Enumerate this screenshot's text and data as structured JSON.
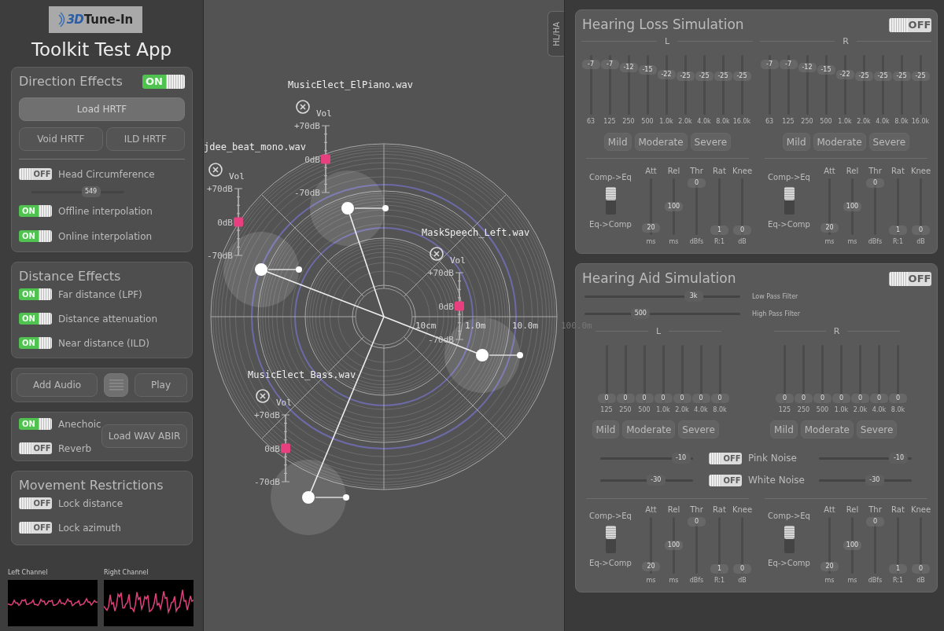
{
  "logo": {
    "mark": "3D",
    "text": "Tune-In"
  },
  "app_title": "Toolkit Test App",
  "direction_effects": {
    "title": "Direction Effects",
    "on": true,
    "switch_text": "ON",
    "load_button": "Load HRTF",
    "buttons": [
      "Void HRTF",
      "ILD HRTF"
    ],
    "head_circumference": {
      "label": "Head Circumference",
      "on": false,
      "switch_text": "OFF",
      "slider": {
        "value": "549",
        "level": 0.64
      }
    },
    "toggles": [
      {
        "label": "Offline interpolation",
        "on": true,
        "switch_text": "ON"
      },
      {
        "label": "Online interpolation",
        "on": true,
        "switch_text": "ON"
      }
    ]
  },
  "distance_effects": {
    "title": "Distance Effects",
    "toggles": [
      {
        "label": "Far distance (LPF)",
        "on": true,
        "switch_text": "ON"
      },
      {
        "label": "Distance attenuation",
        "on": true,
        "switch_text": "ON"
      },
      {
        "label": "Near distance (ILD)",
        "on": true,
        "switch_text": "ON"
      }
    ]
  },
  "audio_controls": [
    {
      "kind": "text",
      "label": "Add Audio"
    },
    {
      "kind": "menu"
    },
    {
      "kind": "text",
      "label": "Play"
    }
  ],
  "environment": {
    "toggles": [
      {
        "label": "Anechoic",
        "on": true,
        "switch_text": "ON"
      },
      {
        "label": "Reverb",
        "on": false,
        "switch_text": "OFF"
      }
    ],
    "button": "Load WAV ABIR"
  },
  "movement_restrictions": {
    "title": "Movement Restrictions",
    "toggles": [
      {
        "label": "Lock distance",
        "on": false,
        "switch_text": "OFF"
      },
      {
        "label": "Lock azimuth",
        "on": false,
        "switch_text": "OFF"
      }
    ]
  },
  "meters": [
    {
      "label": "Left Channel"
    },
    {
      "label": "Right Channel"
    }
  ],
  "scene": {
    "tab": "HL/HA",
    "distance_labels": [
      "10cm",
      "1.0m",
      "10.0m",
      "100.0m"
    ],
    "sources": [
      {
        "name": "MusicElect_ElPiano.wav",
        "vol_label": "Vol",
        "scale_labels": [
          "+70dB",
          "0dB",
          "-70dB"
        ]
      },
      {
        "name": "jdee_beat_mono.wav",
        "vol_label": "Vol",
        "scale_labels": [
          "+70dB",
          "0dB",
          "-70dB"
        ]
      },
      {
        "name": "MaskSpeech_Left.wav",
        "vol_label": "Vol",
        "scale_labels": [
          "+70dB",
          "0dB",
          "-70dB"
        ]
      },
      {
        "name": "MusicElect_Bass.wav",
        "vol_label": "Vol",
        "scale_labels": [
          "+70dB",
          "0dB",
          "-70dB"
        ]
      }
    ]
  },
  "hearing_loss": {
    "title": "Hearing Loss Simulation",
    "on": false,
    "switch_text": "OFF",
    "channels": [
      {
        "label": "L",
        "bands": [
          {
            "value": "-7",
            "freq": "63",
            "level": 0.9
          },
          {
            "value": "-7",
            "freq": "125",
            "level": 0.9
          },
          {
            "value": "-12",
            "freq": "250",
            "level": 0.84
          },
          {
            "value": "-15",
            "freq": "500",
            "level": 0.8
          },
          {
            "value": "-22",
            "freq": "1.0k",
            "level": 0.71
          },
          {
            "value": "-25",
            "freq": "2.0k",
            "level": 0.67
          },
          {
            "value": "-25",
            "freq": "4.0k",
            "level": 0.67
          },
          {
            "value": "-25",
            "freq": "8.0k",
            "level": 0.67
          },
          {
            "value": "-25",
            "freq": "16.0k",
            "level": 0.67
          }
        ],
        "presets": [
          "Mild",
          "Moderate",
          "Severe"
        ],
        "compressor": {
          "upper_label": "Comp->Eq",
          "lower_label": "Eq->Comp",
          "comp_to_eq": true,
          "sliders": [
            {
              "name": "Att",
              "value": "20",
              "unit": "ms",
              "level": 0.05
            },
            {
              "name": "Rel",
              "value": "100",
              "unit": "ms",
              "level": 0.5
            },
            {
              "name": "Thr",
              "value": "0",
              "unit": "dBfs",
              "level": 1
            },
            {
              "name": "Rat",
              "value": "1",
              "unit": "R:1",
              "level": 0
            },
            {
              "name": "Knee",
              "value": "0",
              "unit": "dB",
              "level": 0
            }
          ]
        }
      },
      {
        "label": "R",
        "bands": [
          {
            "value": "-7",
            "freq": "63",
            "level": 0.9
          },
          {
            "value": "-7",
            "freq": "125",
            "level": 0.9
          },
          {
            "value": "-12",
            "freq": "250",
            "level": 0.84
          },
          {
            "value": "-15",
            "freq": "500",
            "level": 0.8
          },
          {
            "value": "-22",
            "freq": "1.0k",
            "level": 0.71
          },
          {
            "value": "-25",
            "freq": "2.0k",
            "level": 0.67
          },
          {
            "value": "-25",
            "freq": "4.0k",
            "level": 0.67
          },
          {
            "value": "-25",
            "freq": "8.0k",
            "level": 0.67
          },
          {
            "value": "-25",
            "freq": "16.0k",
            "level": 0.67
          }
        ],
        "presets": [
          "Mild",
          "Moderate",
          "Severe"
        ],
        "compressor": {
          "upper_label": "Comp->Eq",
          "lower_label": "Eq->Comp",
          "comp_to_eq": true,
          "sliders": [
            {
              "name": "Att",
              "value": "20",
              "unit": "ms",
              "level": 0.05
            },
            {
              "name": "Rel",
              "value": "100",
              "unit": "ms",
              "level": 0.5
            },
            {
              "name": "Thr",
              "value": "0",
              "unit": "dBfs",
              "level": 1
            },
            {
              "name": "Rat",
              "value": "1",
              "unit": "R:1",
              "level": 0
            },
            {
              "name": "Knee",
              "value": "0",
              "unit": "dB",
              "level": 0
            }
          ]
        }
      }
    ]
  },
  "hearing_aid": {
    "title": "Hearing Aid Simulation",
    "on": false,
    "switch_text": "OFF",
    "filters": [
      {
        "label": "Low Pass Filter",
        "value": "3k",
        "level": 0.7
      },
      {
        "label": "High Pass Filter",
        "value": "500",
        "level": 0.36
      }
    ],
    "channels": [
      {
        "label": "L",
        "bands": [
          {
            "value": "0",
            "freq": "125",
            "level": 0
          },
          {
            "value": "0",
            "freq": "250",
            "level": 0
          },
          {
            "value": "0",
            "freq": "500",
            "level": 0
          },
          {
            "value": "0",
            "freq": "1.0k",
            "level": 0
          },
          {
            "value": "0",
            "freq": "2.0k",
            "level": 0
          },
          {
            "value": "0",
            "freq": "4.0k",
            "level": 0
          },
          {
            "value": "0",
            "freq": "8.0k",
            "level": 0
          }
        ],
        "presets": [
          "Mild",
          "Moderate",
          "Severe"
        ],
        "compressor": {
          "upper_label": "Comp->Eq",
          "lower_label": "Eq->Comp",
          "comp_to_eq": true,
          "sliders": [
            {
              "name": "Att",
              "value": "20",
              "unit": "ms",
              "level": 0.05
            },
            {
              "name": "Rel",
              "value": "100",
              "unit": "ms",
              "level": 0.5
            },
            {
              "name": "Thr",
              "value": "0",
              "unit": "dBfs",
              "level": 1
            },
            {
              "name": "Rat",
              "value": "1",
              "unit": "R:1",
              "level": 0
            },
            {
              "name": "Knee",
              "value": "0",
              "unit": "dB",
              "level": 0
            }
          ]
        }
      },
      {
        "label": "R",
        "bands": [
          {
            "value": "0",
            "freq": "125",
            "level": 0
          },
          {
            "value": "0",
            "freq": "250",
            "level": 0
          },
          {
            "value": "0",
            "freq": "500",
            "level": 0
          },
          {
            "value": "0",
            "freq": "1.0k",
            "level": 0
          },
          {
            "value": "0",
            "freq": "2.0k",
            "level": 0
          },
          {
            "value": "0",
            "freq": "4.0k",
            "level": 0
          },
          {
            "value": "0",
            "freq": "8.0k",
            "level": 0
          }
        ],
        "presets": [
          "Mild",
          "Moderate",
          "Severe"
        ],
        "compressor": {
          "upper_label": "Comp->Eq",
          "lower_label": "Eq->Comp",
          "comp_to_eq": true,
          "sliders": [
            {
              "name": "Att",
              "value": "20",
              "unit": "ms",
              "level": 0.05
            },
            {
              "name": "Rel",
              "value": "100",
              "unit": "ms",
              "level": 0.5
            },
            {
              "name": "Thr",
              "value": "0",
              "unit": "dBfs",
              "level": 1
            },
            {
              "name": "Rat",
              "value": "1",
              "unit": "R:1",
              "level": 0
            },
            {
              "name": "Knee",
              "value": "0",
              "unit": "dB",
              "level": 0
            }
          ]
        }
      }
    ],
    "noise": [
      {
        "label": "Pink Noise",
        "on": false,
        "switch_text": "OFF",
        "left": {
          "value": "-10",
          "level": 0.87
        },
        "right": {
          "value": "-10",
          "level": 0.86
        }
      },
      {
        "label": "White Noise",
        "on": false,
        "switch_text": "OFF",
        "left": {
          "value": "-30",
          "level": 0.6
        },
        "right": {
          "value": "-30",
          "level": 0.6
        }
      }
    ]
  }
}
